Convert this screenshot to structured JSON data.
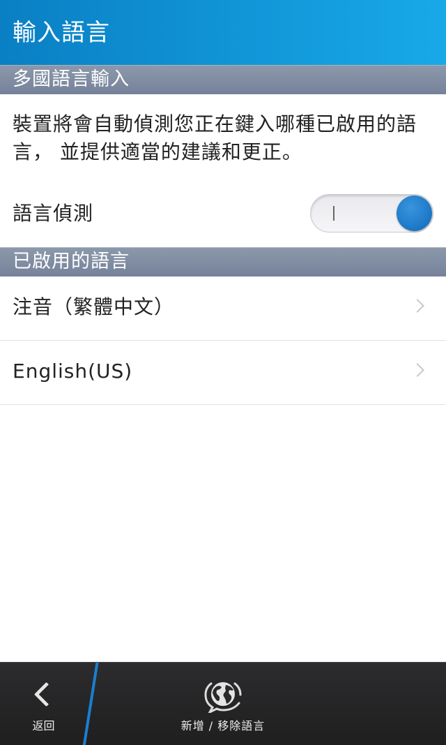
{
  "header": {
    "title": "輸入語言"
  },
  "multilingual": {
    "section_label": "多國語言輸入",
    "description": "裝置將會自動偵測您正在鍵入哪種已啟用的語言， 並提供適當的建議和更正。",
    "toggle_label": "語言偵測",
    "toggle_state": "on"
  },
  "enabled_languages": {
    "section_label": "已啟用的語言",
    "items": [
      {
        "label": "注音（繁體中文）",
        "icon": "chevron-right-icon"
      },
      {
        "label": "English(US)",
        "icon": "chevron-right-icon"
      }
    ]
  },
  "action_bar": {
    "back_label": "返回",
    "back_icon": "back-chevron-icon",
    "add_remove_label": "新增 / 移除語言",
    "add_remove_icon": "globe-speech-icon"
  },
  "colors": {
    "title_bar": "#1196d8",
    "section_header": "#7f8ca1",
    "toggle_knob": "#1b76c5",
    "action_bar": "#262628",
    "divider_accent": "#1a7fd0"
  }
}
